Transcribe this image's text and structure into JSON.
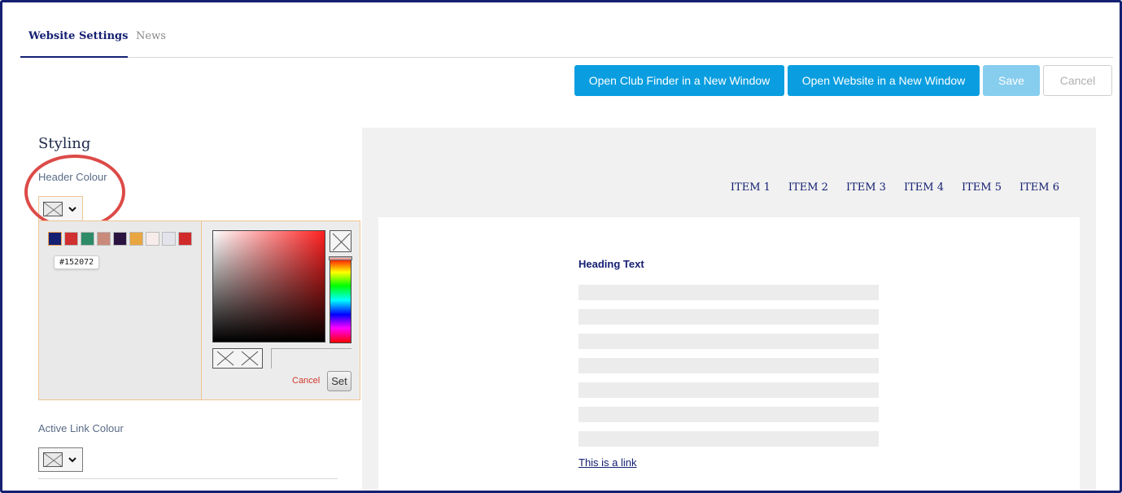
{
  "tabs": [
    {
      "label": "Website Settings",
      "active": true
    },
    {
      "label": "News",
      "active": false
    }
  ],
  "toolbar": {
    "open_club_finder_label": "Open Club Finder in a New Window",
    "open_website_label": "Open Website in a New Window",
    "save_label": "Save",
    "cancel_label": "Cancel"
  },
  "styling": {
    "title": "Styling",
    "header_colour_label": "Header Colour",
    "active_link_colour_label": "Active Link Colour"
  },
  "color_picker": {
    "palette": [
      "#152072",
      "#d0302f",
      "#2e8b68",
      "#c98a7c",
      "#2a1340",
      "#e8a540",
      "#f7ecea",
      "#e3e3ec",
      "#d02a2a"
    ],
    "tooltip": "#152072",
    "cancel_label": "Cancel",
    "set_label": "Set",
    "hex_value": ""
  },
  "preview": {
    "nav_items": [
      "ITEM 1",
      "ITEM 2",
      "ITEM 3",
      "ITEM 4",
      "ITEM 5",
      "ITEM 6"
    ],
    "heading": "Heading Text",
    "link_text": "This is a link",
    "placeholder_line_count": 7
  },
  "colors": {
    "brand_navy": "#152072",
    "primary_button": "#0a9ee0",
    "save_disabled": "#86cdee",
    "highlight_ring": "#dc4a47"
  }
}
